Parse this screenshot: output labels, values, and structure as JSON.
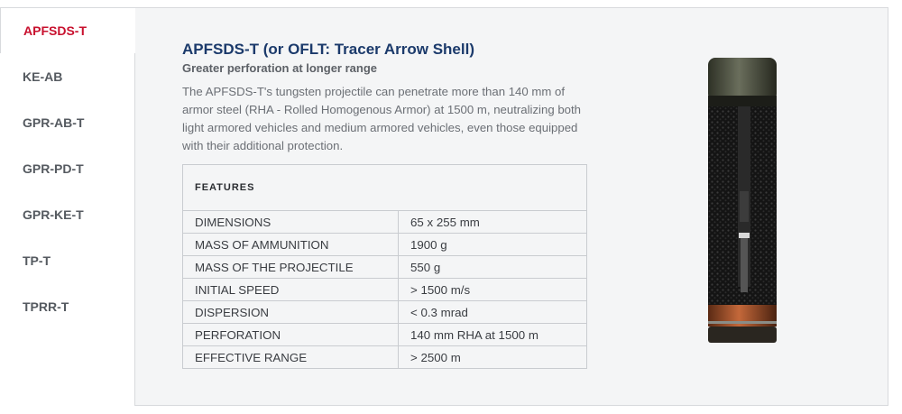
{
  "tabs": [
    {
      "label": "APFSDS-T",
      "active": true
    },
    {
      "label": "KE-AB",
      "active": false
    },
    {
      "label": "GPR-AB-T",
      "active": false
    },
    {
      "label": "GPR-PD-T",
      "active": false
    },
    {
      "label": "GPR-KE-T",
      "active": false
    },
    {
      "label": "TP-T",
      "active": false
    },
    {
      "label": "TPRR-T",
      "active": false
    }
  ],
  "content": {
    "title": "APFSDS-T (or OFLT: Tracer Arrow Shell)",
    "subtitle": "Greater perforation at longer range",
    "description": "The APFSDS-T's tungsten projectile can penetrate more than 140 mm of armor steel (RHA - Rolled Homogenous Armor) at 1500 m, neutralizing both light armored vehicles and medium armored vehicles, even those equipped with their additional protection."
  },
  "features": {
    "header": "FEATURES",
    "rows": [
      {
        "name": "DIMENSIONS",
        "value": "65 x 255 mm"
      },
      {
        "name": "MASS OF AMMUNITION",
        "value": "1900 g"
      },
      {
        "name": "MASS OF THE PROJECTILE",
        "value": "550 g"
      },
      {
        "name": "INITIAL SPEED",
        "value": "> 1500 m/s"
      },
      {
        "name": "DISPERSION",
        "value": "< 0.3 mrad"
      },
      {
        "name": "PERFORATION",
        "value": "140 mm RHA at 1500 m"
      },
      {
        "name": "EFFECTIVE RANGE",
        "value": "> 2500 m"
      }
    ]
  },
  "colors": {
    "accent": "#c8102e",
    "title": "#1b3a6b",
    "panel_bg": "#f4f5f6"
  }
}
